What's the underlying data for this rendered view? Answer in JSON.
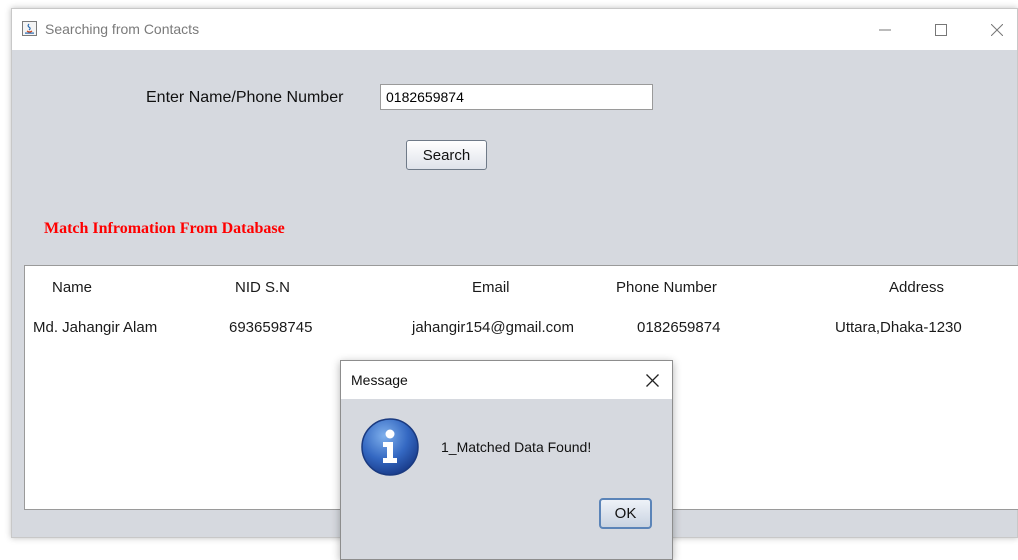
{
  "window": {
    "title": "Searching from Contacts",
    "icons": [
      "java-app-icon",
      "minimize-icon",
      "maximize-icon",
      "close-icon"
    ]
  },
  "search": {
    "label": "Enter Name/Phone Number",
    "value": "0182659874",
    "button_label": "Search"
  },
  "results": {
    "heading": "Match Infromation From Database",
    "heading_color": "#ff0000",
    "columns": [
      "Name",
      "NID S.N",
      "Email",
      "Phone Number",
      "Address"
    ],
    "rows": [
      [
        "Md. Jahangir Alam",
        "6936598745",
        "jahangir154@gmail.com",
        "0182659874",
        "Uttara,Dhaka-1230"
      ]
    ]
  },
  "dialog": {
    "title": "Message",
    "message": "1_Matched Data Found!",
    "ok_label": "OK",
    "icon": "info-icon"
  }
}
